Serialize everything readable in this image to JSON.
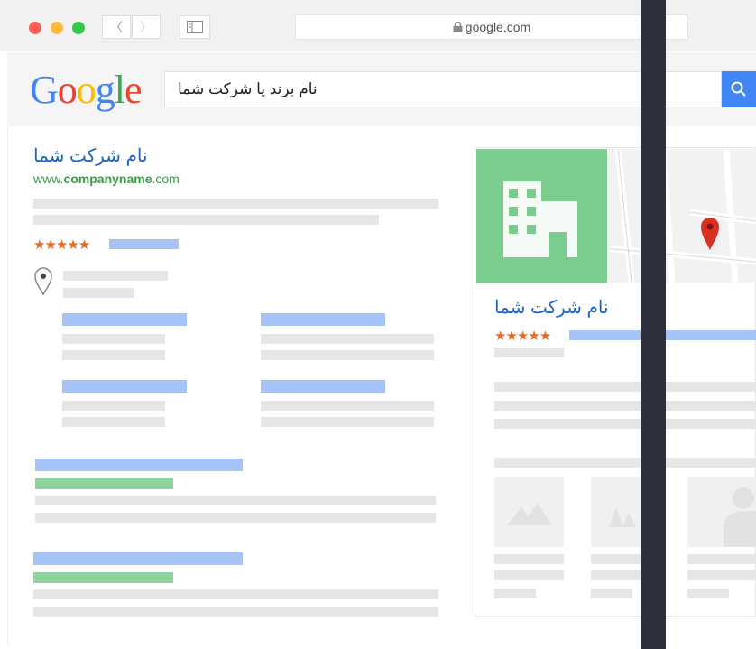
{
  "browser": {
    "url": "google.com",
    "back_glyph": "〈",
    "forward_glyph": "〉",
    "sidebar_glyph": "▢",
    "lock_icon": "lock-icon",
    "dots": {
      "close": "#fc605b",
      "minimize": "#fdbc40",
      "zoom": "#34c84a"
    }
  },
  "google": {
    "logo_letters": [
      {
        "ch": "G",
        "color": "#4285f4"
      },
      {
        "ch": "o",
        "color": "#ea4335"
      },
      {
        "ch": "o",
        "color": "#fbbc05"
      },
      {
        "ch": "g",
        "color": "#4285f4"
      },
      {
        "ch": "l",
        "color": "#34a853"
      },
      {
        "ch": "e",
        "color": "#ea4335"
      }
    ],
    "search_query": "نام برند یا شرکت شما",
    "search_icon": "⚲"
  },
  "result": {
    "title": "نام شرکت شما",
    "url_prefix": "www.",
    "url_bold": "companyname",
    "url_suffix": ".com",
    "stars": "★★★★★",
    "rating": 5,
    "pin_icon": "map-pin-icon"
  },
  "panel": {
    "title": "نام شرکت شما",
    "stars": "★★★★★",
    "rating": 5,
    "building_icon": "building-icon",
    "map_pin_icon": "map-marker-icon",
    "thumbnails": [
      "mountains-image-icon",
      "trees-image-icon",
      "person-image-icon"
    ]
  },
  "colors": {
    "link_blue": "#1a63c8",
    "url_green": "#3e9a48",
    "star_orange": "#e76a24",
    "panel_green": "#7bcd8e",
    "divider": "#2d2f3d"
  }
}
